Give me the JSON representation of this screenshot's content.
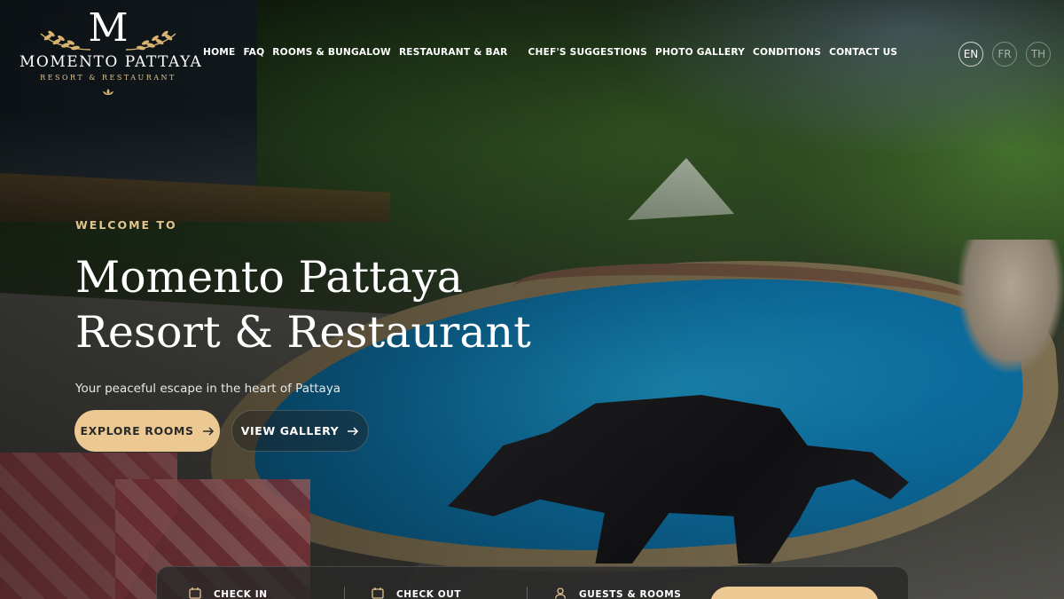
{
  "brand": {
    "monogram": "M",
    "name": "MOMENTO PATTAYA",
    "subtitle": "RESORT & RESTAURANT"
  },
  "nav": {
    "items": [
      {
        "label": "HOME"
      },
      {
        "label": "FAQ"
      },
      {
        "label": "ROOMS & BUNGALOW"
      },
      {
        "label": "RESTAURANT & BAR"
      },
      {
        "label": "CHEF'S SUGGESTIONS"
      },
      {
        "label": "PHOTO GALLERY"
      },
      {
        "label": "CONDITIONS"
      },
      {
        "label": "CONTACT US"
      }
    ]
  },
  "languages": {
    "items": [
      {
        "code": "EN",
        "active": true
      },
      {
        "code": "FR",
        "active": false
      },
      {
        "code": "TH",
        "active": false
      }
    ]
  },
  "hero": {
    "eyebrow": "WELCOME TO",
    "title_line1": "Momento Pattaya",
    "title_line2": "Resort & Restaurant",
    "tagline": "Your peaceful escape in the heart of Pattaya",
    "primary_button": "EXPLORE ROOMS",
    "secondary_button": "VIEW GALLERY"
  },
  "booking": {
    "check_in_label": "CHECK IN",
    "check_out_label": "CHECK OUT",
    "guests_label": "GUESTS & ROOMS"
  },
  "colors": {
    "accent_gold": "#ecc993",
    "eyebrow_gold": "#e4c48d",
    "booking_bar": "#282828"
  },
  "icons": {
    "check_in": "calendar-icon",
    "check_out": "calendar-icon",
    "guests": "user-icon",
    "button_arrow": "arrow-right-icon"
  }
}
